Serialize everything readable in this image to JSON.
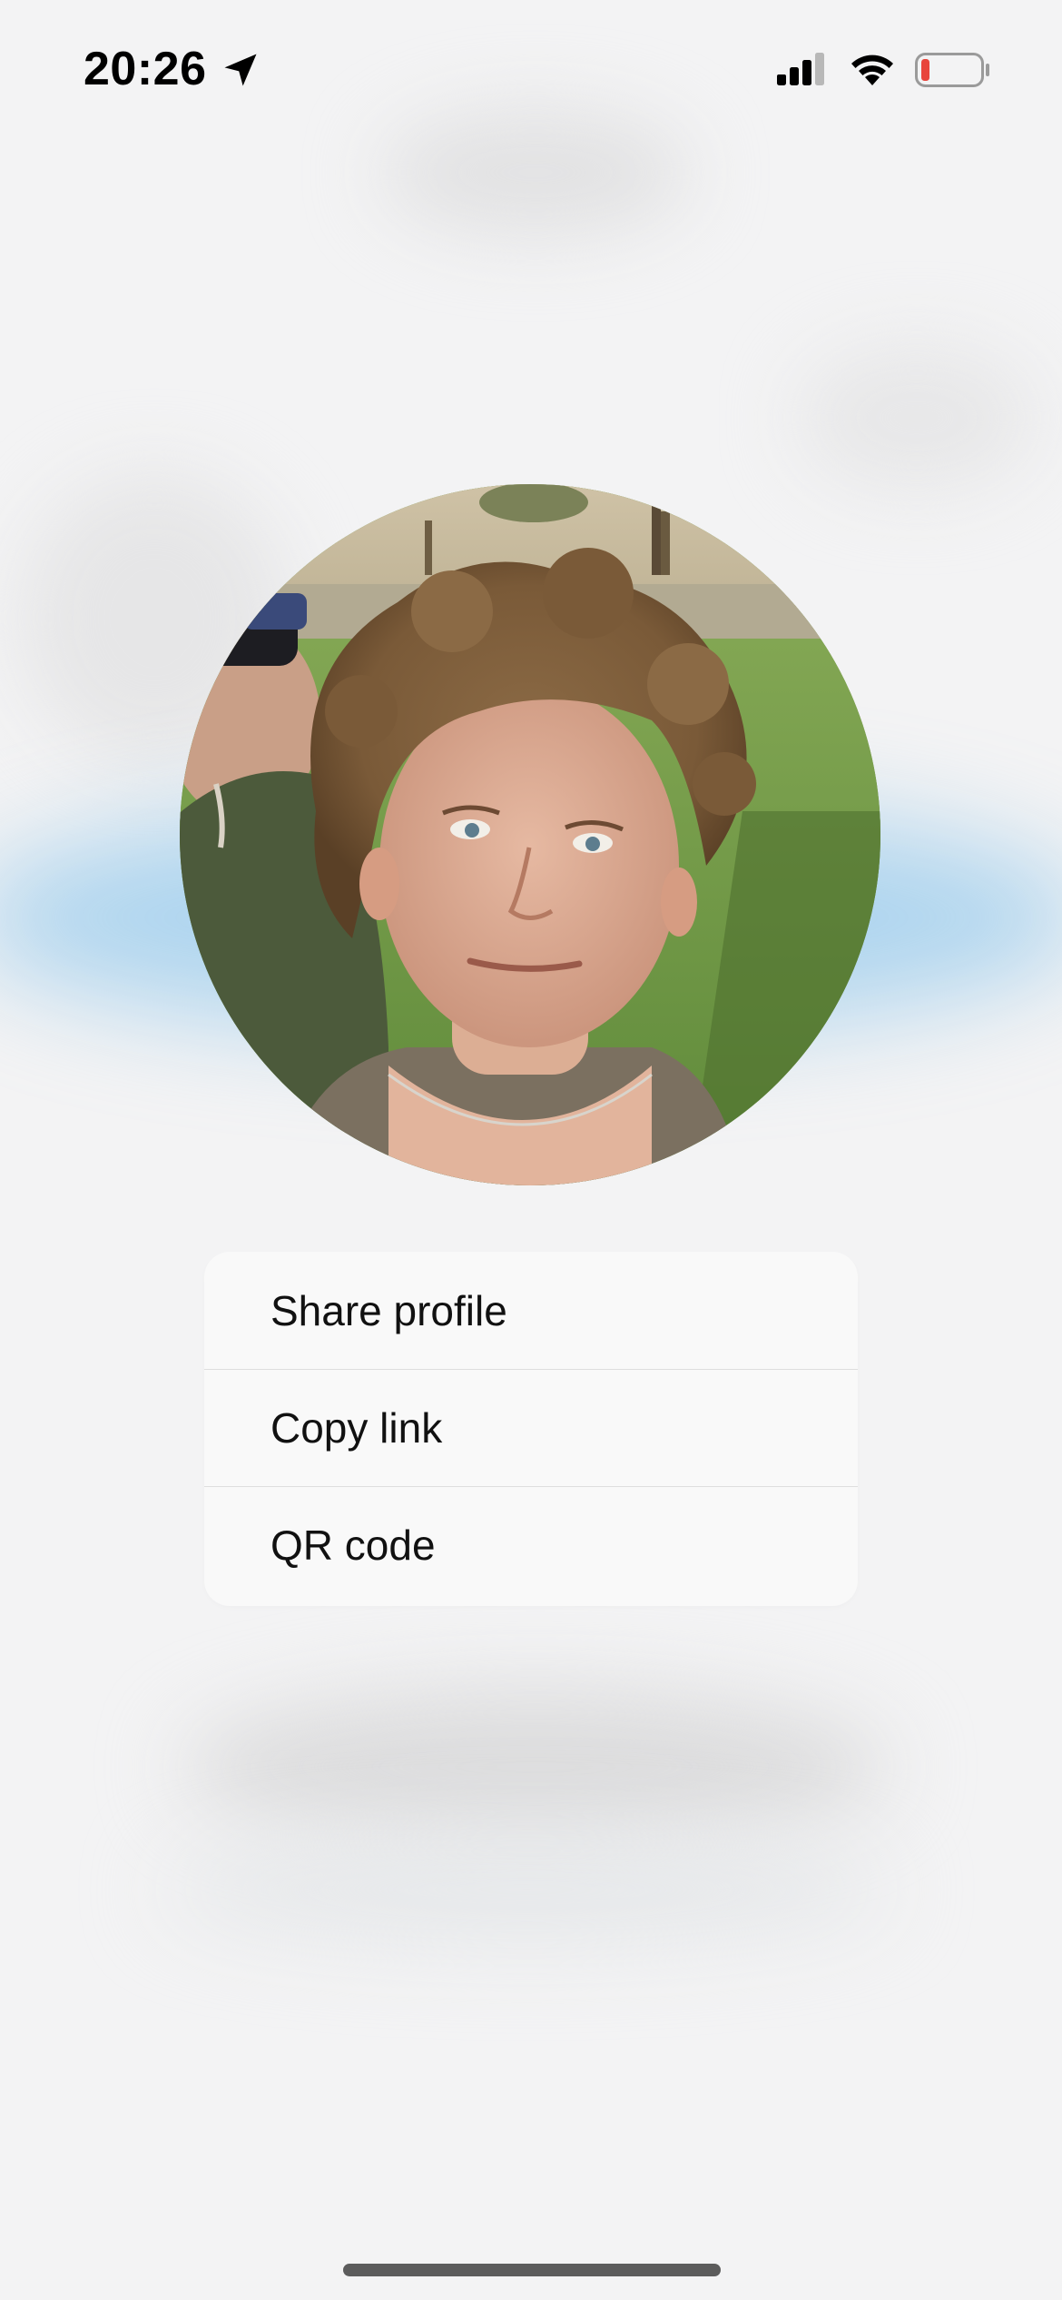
{
  "status_bar": {
    "time": "20:26",
    "icons": [
      "location-arrow-icon",
      "cellular-signal-icon",
      "wifi-icon",
      "battery-low-icon"
    ],
    "battery_color": "#e8453c"
  },
  "profile": {
    "avatar_icon": "profile-photo"
  },
  "menu": {
    "items": [
      {
        "label": "Share profile"
      },
      {
        "label": "Copy link"
      },
      {
        "label": "QR code"
      }
    ]
  },
  "colors": {
    "background": "#f3f3f4",
    "menu_background": "#f9f9f9",
    "glow": "#78beeb"
  }
}
